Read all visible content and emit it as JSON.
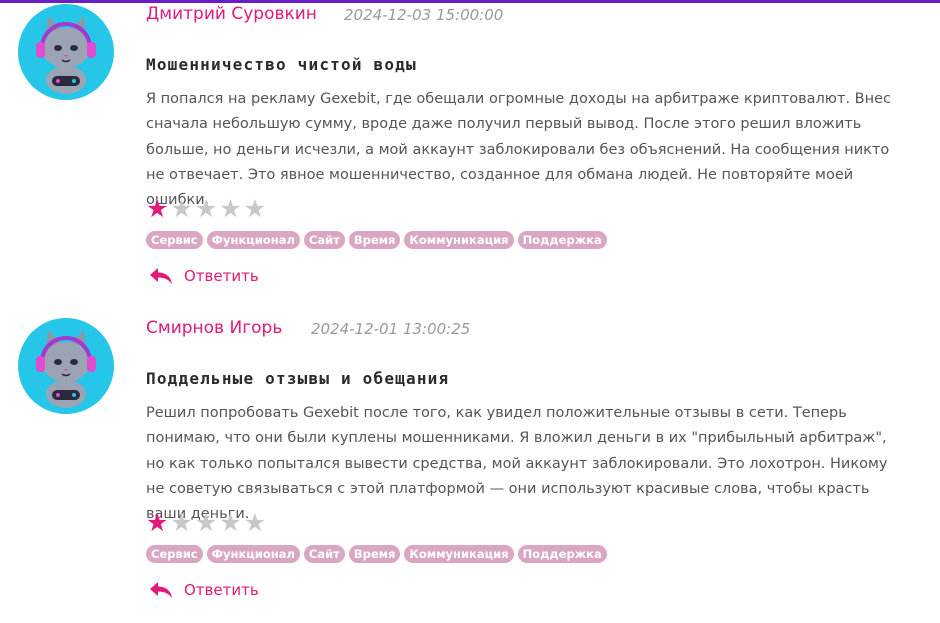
{
  "reviews": [
    {
      "author": "Дмитрий Суровкин",
      "date": "2024-12-03 15:00:00",
      "title": "Мошенничество чистой воды",
      "text": "Я попался на рекламу Gexebit, где обещали огромные доходы на арбитраже криптовалют. Внес сначала небольшую сумму, вроде даже получил первый вывод. После этого решил вложить больше, но деньги исчезли, а мой аккаунт заблокировали без объяснений. На сообщения никто не отвечает. Это явное мошенничество, созданное для обмана людей. Не повторяйте моей ошибки.",
      "rating": 1,
      "rating_max": 5,
      "tags": [
        "Сервис",
        "Функционал",
        "Сайт",
        "Время",
        "Коммуникация",
        "Поддержка"
      ],
      "reply_label": "Ответить"
    },
    {
      "author": "Смирнов Игорь",
      "date": "2024-12-01 13:00:25",
      "title": "Поддельные отзывы и обещания",
      "text": "Решил попробовать Gexebit после того, как увидел положительные отзывы в сети. Теперь понимаю, что они были куплены мошенниками. Я вложил деньги в их \"прибыльный арбитраж\", но как только попытался вывести средства, мой аккаунт заблокировали. Это лохотрон. Никому не советую связываться с этой платформой — они используют красивые слова, чтобы красть ваши деньги.",
      "rating": 1,
      "rating_max": 5,
      "tags": [
        "Сервис",
        "Функционал",
        "Сайт",
        "Время",
        "Коммуникация",
        "Поддержка"
      ],
      "reply_label": "Ответить"
    }
  ],
  "colors": {
    "accent": "#e0197a",
    "avatar_bg": "#25c6e8",
    "tag_bg": "#d9a6c4",
    "star_off": "#c8c8c8",
    "top_bar": "#6a1fc4"
  },
  "icons": {
    "avatar": "cat-gamer-avatar-icon",
    "reply": "reply-arrow-icon",
    "star": "star-icon"
  }
}
